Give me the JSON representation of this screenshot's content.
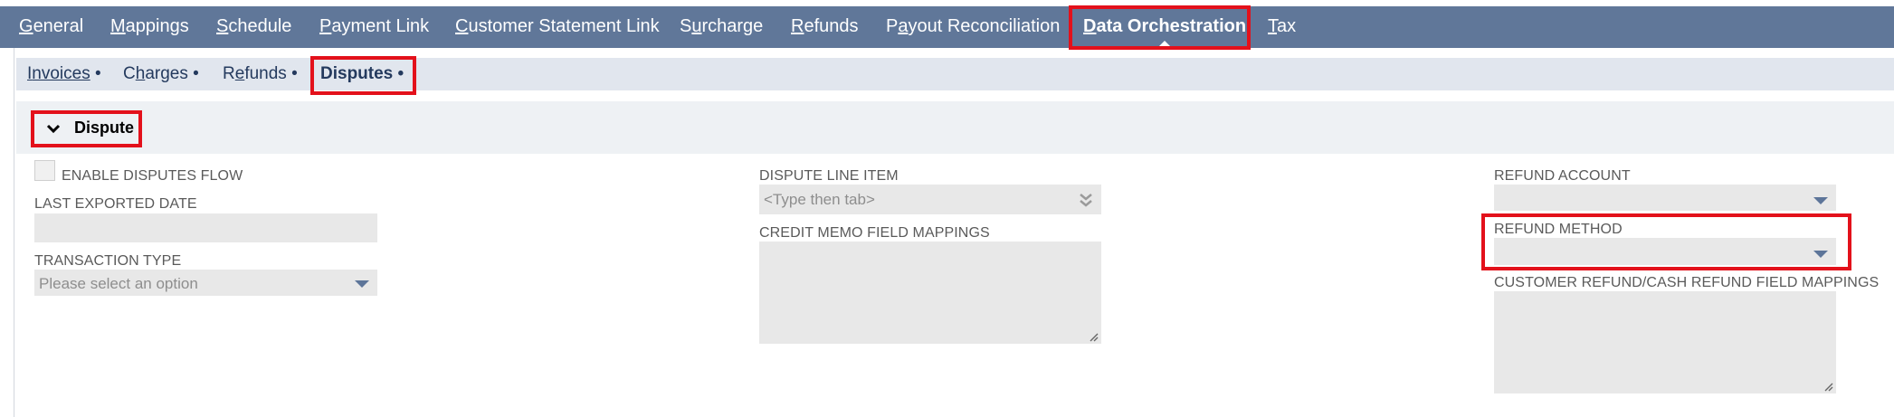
{
  "top_tabs": [
    {
      "pre": "",
      "key": "G",
      "post": "eneral"
    },
    {
      "pre": "",
      "key": "M",
      "post": "appings"
    },
    {
      "pre": "",
      "key": "S",
      "post": "chedule"
    },
    {
      "pre": "",
      "key": "P",
      "post": "ayment Link"
    },
    {
      "pre": "",
      "key": "C",
      "post": "ustomer Statement Link"
    },
    {
      "pre": "S",
      "key": "u",
      "post": "rcharge"
    },
    {
      "pre": "",
      "key": "R",
      "post": "efunds"
    },
    {
      "pre": "P",
      "key": "a",
      "post": "yout Reconciliation"
    },
    {
      "pre": "",
      "key": "D",
      "post": "ata Orchestration"
    },
    {
      "pre": "",
      "key": "T",
      "post": "ax"
    }
  ],
  "sub_tabs": [
    {
      "pre": "",
      "key": "I",
      "post": "nvoices",
      "dot": "•"
    },
    {
      "pre": "C",
      "key": "h",
      "post": "arges",
      "dot": "•"
    },
    {
      "pre": "R",
      "key": "e",
      "post": "funds",
      "dot": "•"
    },
    {
      "pre": "",
      "key": "",
      "post": "Disputes",
      "dot": "•"
    }
  ],
  "section": {
    "title": "Dispute"
  },
  "form": {
    "enable_disputes_flow": {
      "label": "ENABLE DISPUTES FLOW",
      "checked": false
    },
    "last_exported_date": {
      "label": "LAST EXPORTED DATE",
      "value": ""
    },
    "transaction_type": {
      "label": "TRANSACTION TYPE",
      "placeholder": "Please select an option"
    },
    "dispute_line_item": {
      "label": "DISPUTE LINE ITEM",
      "placeholder": "<Type then tab>"
    },
    "credit_memo_field_mappings": {
      "label": "CREDIT MEMO FIELD MAPPINGS",
      "value": ""
    },
    "refund_account": {
      "label": "REFUND ACCOUNT",
      "value": ""
    },
    "refund_method": {
      "label": "REFUND METHOD",
      "value": ""
    },
    "customer_refund_mappings": {
      "label": "CUSTOMER REFUND/CASH REFUND FIELD MAPPINGS",
      "value": ""
    }
  },
  "colors": {
    "nav_bg": "#607799",
    "subnav_bg": "#e1e6ee",
    "highlight": "#e3111b",
    "field_bg": "#e8e8e8"
  }
}
